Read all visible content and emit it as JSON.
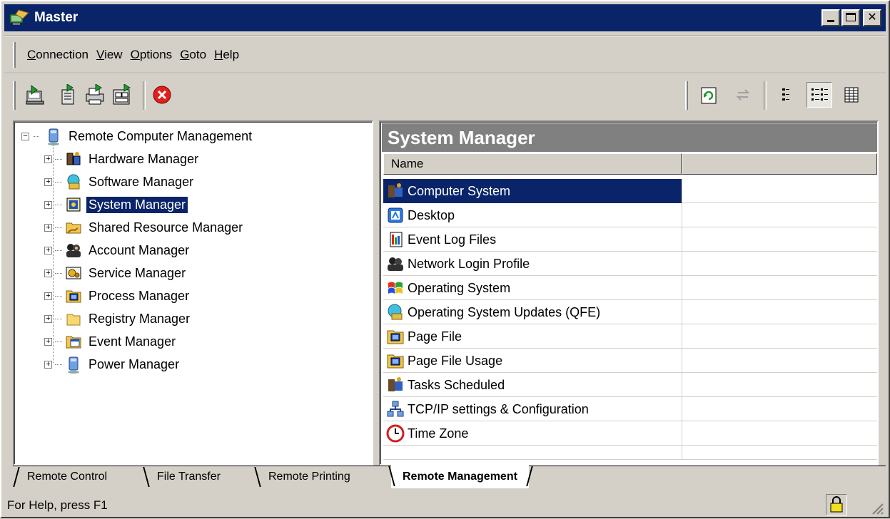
{
  "window": {
    "title": "Master",
    "minimize_glyph": "_",
    "maximize_glyph": "□",
    "close_glyph": "✕"
  },
  "menu": {
    "items": [
      {
        "label": "Connection",
        "accel": "C",
        "rest": "onnection"
      },
      {
        "label": "View",
        "accel": "V",
        "rest": "iew"
      },
      {
        "label": "Options",
        "accel": "O",
        "rest": "ptions"
      },
      {
        "label": "Goto",
        "accel": "G",
        "rest": "oto"
      },
      {
        "label": "Help",
        "accel": "H",
        "rest": "elp"
      }
    ]
  },
  "toolbar": {
    "left_tools": [
      "connect-icon",
      "file-transfer-icon",
      "remote-print-icon",
      "remote-manage-icon",
      "disconnect-icon"
    ],
    "right_tools": [
      "refresh-icon",
      "sync-icon",
      "list-view-icon",
      "details-view-icon",
      "report-view-icon"
    ]
  },
  "tree": {
    "root": {
      "label": "Remote Computer Management",
      "expander": "−",
      "icon": "computer-icon"
    },
    "items": [
      {
        "label": "Hardware Manager",
        "icon": "hardware-icon",
        "selected": false
      },
      {
        "label": "Software Manager",
        "icon": "software-icon",
        "selected": false
      },
      {
        "label": "System Manager",
        "icon": "system-icon",
        "selected": true
      },
      {
        "label": "Shared Resource Manager",
        "icon": "shared-folder-icon",
        "selected": false
      },
      {
        "label": "Account Manager",
        "icon": "users-icon",
        "selected": false
      },
      {
        "label": "Service Manager",
        "icon": "service-icon",
        "selected": false
      },
      {
        "label": "Process Manager",
        "icon": "process-icon",
        "selected": false
      },
      {
        "label": "Registry Manager",
        "icon": "registry-folder-icon",
        "selected": false
      },
      {
        "label": "Event Manager",
        "icon": "event-icon",
        "selected": false
      },
      {
        "label": "Power Manager",
        "icon": "power-icon",
        "selected": false
      }
    ],
    "expander_plus": "+"
  },
  "right": {
    "header": "System Manager",
    "columns": [
      "Name",
      ""
    ],
    "rows": [
      {
        "name": "Computer System",
        "icon": "computer-system-icon",
        "selected": true
      },
      {
        "name": "Desktop",
        "icon": "desktop-icon",
        "selected": false
      },
      {
        "name": "Event Log Files",
        "icon": "event-log-icon",
        "selected": false
      },
      {
        "name": "Network Login Profile",
        "icon": "network-login-icon",
        "selected": false
      },
      {
        "name": "Operating System",
        "icon": "windows-logo-icon",
        "selected": false
      },
      {
        "name": "Operating System Updates (QFE)",
        "icon": "updates-icon",
        "selected": false
      },
      {
        "name": "Page File",
        "icon": "page-file-icon",
        "selected": false
      },
      {
        "name": "Page File Usage",
        "icon": "page-file-usage-icon",
        "selected": false
      },
      {
        "name": "Tasks Scheduled",
        "icon": "tasks-icon",
        "selected": false
      },
      {
        "name": "TCP/IP settings & Configuration",
        "icon": "network-icon",
        "selected": false
      },
      {
        "name": "Time Zone",
        "icon": "clock-icon",
        "selected": false
      }
    ]
  },
  "tabs": [
    {
      "label": "Remote Control",
      "active": false
    },
    {
      "label": "File Transfer",
      "active": false
    },
    {
      "label": "Remote Printing",
      "active": false
    },
    {
      "label": "Remote Management",
      "active": true
    }
  ],
  "status": {
    "text": "For Help, press F1"
  },
  "colors": {
    "title_bar": "#0a246a",
    "selection": "#0a246a",
    "face": "#d4d0c8",
    "header_gray": "#808080"
  }
}
